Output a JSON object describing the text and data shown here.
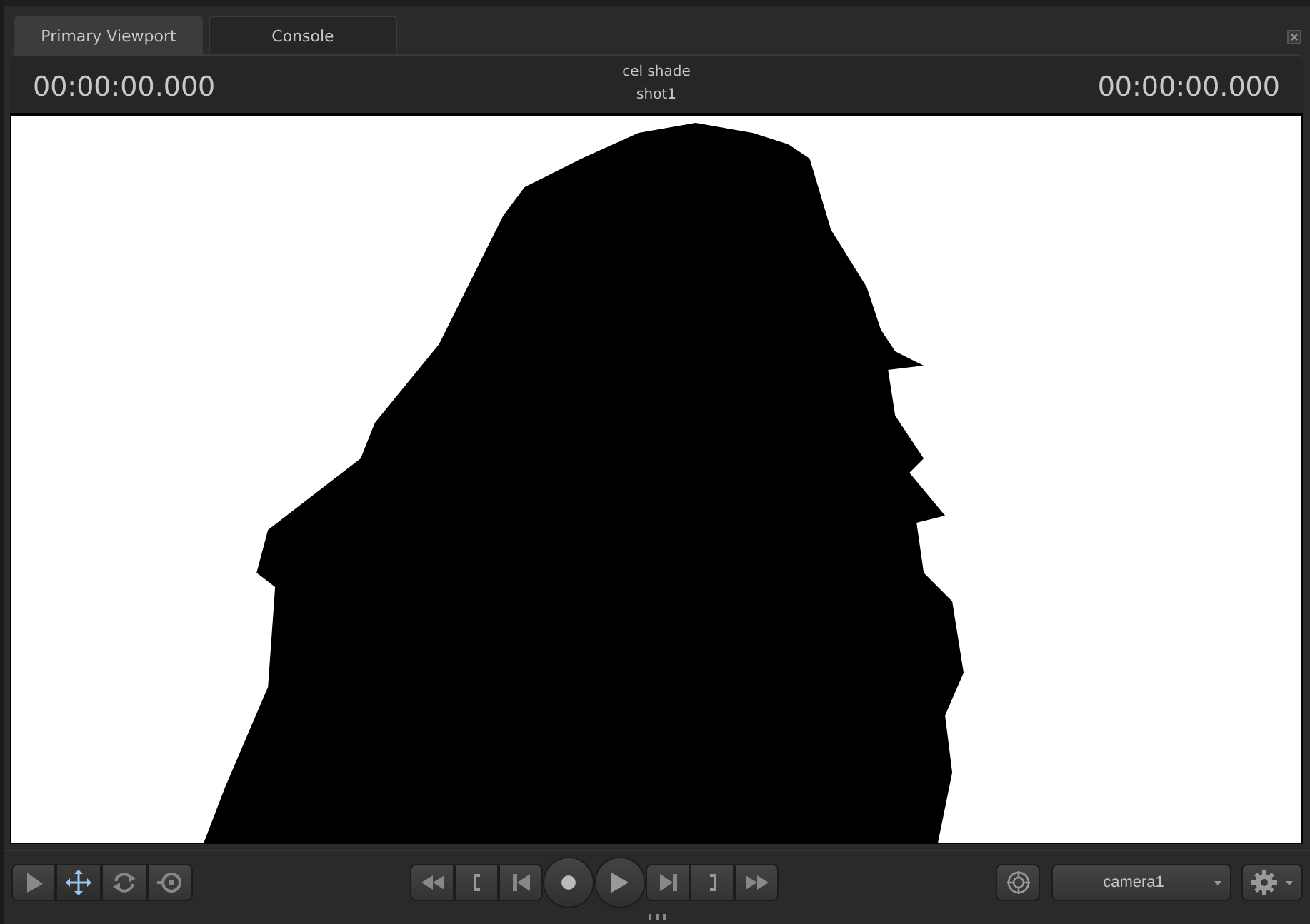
{
  "tabs": [
    {
      "label": "Primary Viewport",
      "selected": true
    },
    {
      "label": "Console",
      "selected": false
    }
  ],
  "header": {
    "timecode_left": "00:00:00.000",
    "title": "cel shade",
    "subtitle": "shot1",
    "timecode_right": "00:00:00.000"
  },
  "tools": [
    {
      "kind": "select",
      "selected": false
    },
    {
      "kind": "move",
      "selected": true
    },
    {
      "kind": "rotate",
      "selected": false
    },
    {
      "kind": "orbit",
      "selected": false
    }
  ],
  "camera": {
    "value": "camera1"
  }
}
